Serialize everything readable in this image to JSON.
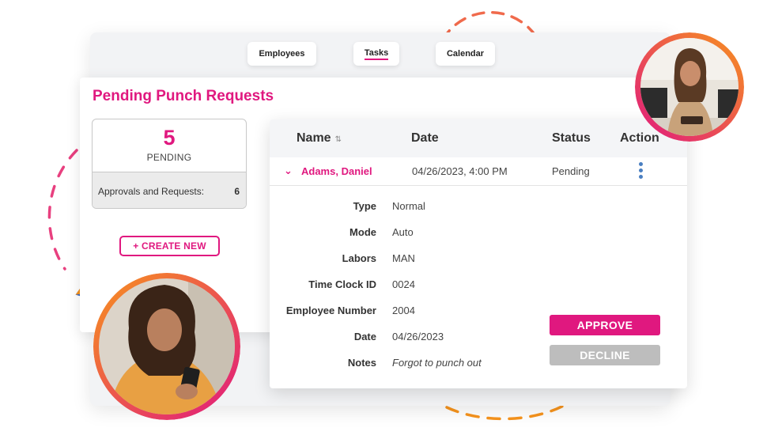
{
  "nav": {
    "tabs": [
      "Employees",
      "Tasks",
      "Calendar"
    ],
    "active_tab": "Tasks"
  },
  "page": {
    "title": "Pending Punch Requests"
  },
  "summary": {
    "count": "5",
    "label": "PENDING",
    "footer_label": "Approvals and Requests:",
    "footer_value": "6"
  },
  "create_button": "+ CREATE NEW",
  "table": {
    "headers": {
      "name": "Name",
      "date": "Date",
      "status": "Status",
      "action": "Action"
    },
    "row": {
      "name": "Adams, Daniel",
      "date": "04/26/2023, 4:00 PM",
      "status": "Pending"
    }
  },
  "details": [
    {
      "label": "Type",
      "value": "Normal"
    },
    {
      "label": "Mode",
      "value": "Auto"
    },
    {
      "label": "Labors",
      "value": "MAN"
    },
    {
      "label": "Time Clock ID",
      "value": "0024"
    },
    {
      "label": "Employee Number",
      "value": "2004"
    },
    {
      "label": "Date",
      "value": "04/26/2023"
    },
    {
      "label": "Notes",
      "value": "Forgot to punch out"
    }
  ],
  "buttons": {
    "approve": "APPROVE",
    "decline": "DECLINE"
  },
  "icons": {
    "sort": "sort-icon",
    "expand": "chevron-down-icon",
    "action_menu": "kebab-menu-icon"
  },
  "colors": {
    "accent": "#e0187f",
    "decline": "#bdbdbd",
    "kebab": "#4a7fc1",
    "ring_start": "#e0187f",
    "ring_end": "#f7941d"
  }
}
